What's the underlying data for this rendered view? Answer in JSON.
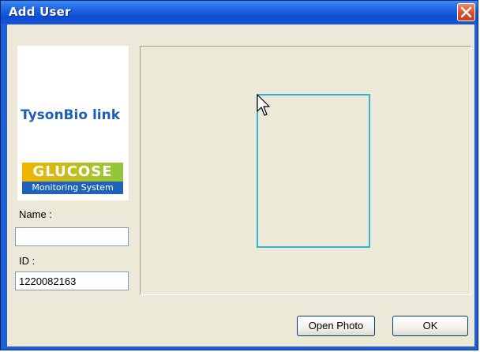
{
  "window": {
    "title": "Add User"
  },
  "logos": {
    "brand": "TysonBio link",
    "glucose_title": "GLUCOSE",
    "glucose_subtitle": "Monitoring System"
  },
  "form": {
    "name_label": "Name :",
    "name_value": "",
    "id_label": "ID :",
    "id_value": "1220082163"
  },
  "buttons": {
    "open_photo": "Open Photo",
    "ok": "OK"
  },
  "icons": {
    "close": "close-icon",
    "cursor": "mouse-cursor-icon"
  },
  "colors": {
    "titlebar": "#0c4ed4",
    "close_button": "#e0502c",
    "photo_frame": "#2fb8c8",
    "dialog_background": "#ece9d8"
  }
}
